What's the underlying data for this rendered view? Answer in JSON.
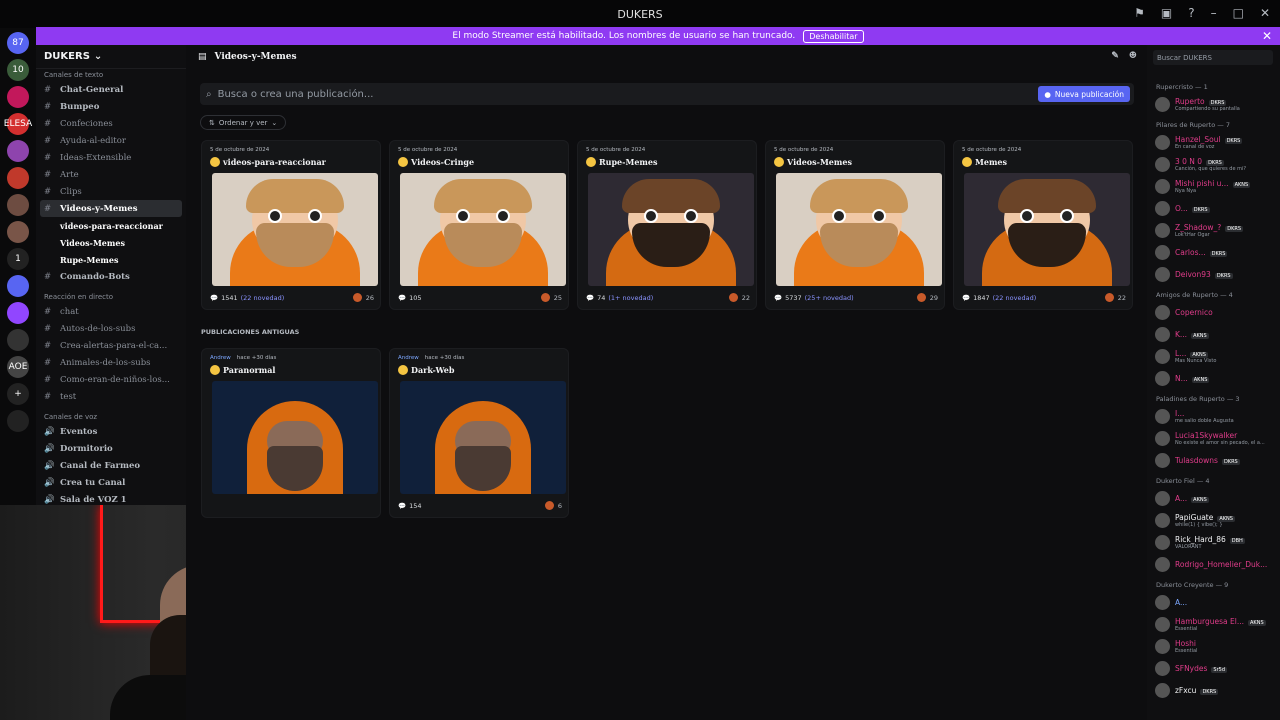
{
  "window": {
    "title": "DUKERS"
  },
  "banner": {
    "text": "El modo Streamer está habilitado. Los nombres de usuario se han truncado.",
    "button": "Deshabilitar"
  },
  "guilds": [
    {
      "label": "87",
      "color": "#5865f2"
    },
    {
      "label": "10",
      "color": "#3a5c3a"
    },
    {
      "label": "",
      "color": "#c2185b"
    },
    {
      "label": "ELESA",
      "color": "#d32f2f"
    },
    {
      "label": "",
      "color": "#8e44ad"
    },
    {
      "label": "",
      "color": "#c0392b"
    },
    {
      "label": "",
      "color": "#6d4c41"
    },
    {
      "label": "",
      "color": "#795548"
    },
    {
      "label": "1",
      "color": "#222"
    },
    {
      "label": "",
      "color": "#5865f2"
    },
    {
      "label": "",
      "color": "#9146ff"
    },
    {
      "label": "",
      "color": "#333"
    },
    {
      "label": "AOE",
      "color": "#444"
    },
    {
      "label": "+",
      "color": "#222"
    },
    {
      "label": "",
      "color": "#222"
    }
  ],
  "server": {
    "name": "DUKERS",
    "text_category": "Canales de texto",
    "channels": [
      {
        "label": "Chat-General",
        "icon": "#",
        "muted": false,
        "sub": false,
        "active": false
      },
      {
        "label": "Bumpeo",
        "icon": "#",
        "muted": false,
        "sub": false,
        "active": false
      },
      {
        "label": "Confeciones",
        "icon": "#",
        "muted": true,
        "sub": false,
        "active": false
      },
      {
        "label": "Ayuda-al-editor",
        "icon": "#",
        "muted": true,
        "sub": false,
        "active": false
      },
      {
        "label": "Ideas-Extensible",
        "icon": "#",
        "muted": true,
        "sub": false,
        "active": false
      },
      {
        "label": "Arte",
        "icon": "#",
        "muted": true,
        "sub": false,
        "active": false
      },
      {
        "label": "Clips",
        "icon": "#",
        "muted": true,
        "sub": false,
        "active": false
      },
      {
        "label": "Videos-y-Memes",
        "icon": "#",
        "muted": false,
        "sub": false,
        "active": true
      },
      {
        "label": "videos-para-reaccionar",
        "icon": "",
        "muted": false,
        "sub": true,
        "active": false
      },
      {
        "label": "Videos-Memes",
        "icon": "",
        "muted": false,
        "sub": true,
        "active": false
      },
      {
        "label": "Rupe-Memes",
        "icon": "",
        "muted": false,
        "sub": true,
        "active": false
      },
      {
        "label": "Comando-Bots",
        "icon": "",
        "muted": false,
        "sub": false,
        "active": false
      }
    ],
    "live_category": "Reacción en directo",
    "live_channels": [
      {
        "label": "chat"
      },
      {
        "label": "Autos-de-los-subs"
      },
      {
        "label": "Crea-alertas-para-el-ca..."
      },
      {
        "label": "Animales-de-los-subs"
      },
      {
        "label": "Como-eran-de-niños-los..."
      },
      {
        "label": "test"
      }
    ],
    "voice_category": "Canales de voz",
    "voice_channels": [
      {
        "label": "Eventos"
      },
      {
        "label": "Dormitorio"
      },
      {
        "label": "Canal de Farmeo"
      },
      {
        "label": "Crea tu Canal"
      },
      {
        "label": "Sala de VOZ 1"
      }
    ]
  },
  "main": {
    "channel_title": "Videos-y-Memes",
    "search_placeholder": "Busca o crea una publicación...",
    "new_post": "Nueva publicación",
    "sort": "Ordenar y ver",
    "old_posts": "PUBLICACIONES ANTIGUAS",
    "posts": [
      {
        "date": "5 de octubre de 2024",
        "title": "videos-para-reaccionar",
        "count": "1541",
        "novelty": "(22 novedad)",
        "reactions": "26",
        "art": "light"
      },
      {
        "date": "5 de octubre de 2024",
        "title": "Videos-Cringe",
        "count": "105",
        "novelty": "",
        "reactions": "25",
        "art": "light"
      },
      {
        "date": "5 de octubre de 2024",
        "title": "Rupe-Memes",
        "count": "74",
        "novelty": "(1+ novedad)",
        "reactions": "22",
        "art": "dark"
      },
      {
        "date": "5 de octubre de 2024",
        "title": "Videos-Memes",
        "count": "5737",
        "novelty": "(25+ novedad)",
        "reactions": "29",
        "art": "light"
      },
      {
        "date": "5 de octubre de 2024",
        "title": "Memes",
        "count": "1847",
        "novelty": "(22 novedad)",
        "reactions": "22",
        "art": "dark"
      }
    ],
    "old": [
      {
        "author": "Andrew",
        "date": "hace +30 días",
        "title": "Paranormal",
        "count": "",
        "reactions": "",
        "art": "night"
      },
      {
        "author": "Andrew",
        "date": "hace +30 días",
        "title": "Dark-Web",
        "count": "154",
        "reactions": "6",
        "art": "night"
      }
    ]
  },
  "members": {
    "search_placeholder": "Buscar DUKERS",
    "groups": [
      {
        "name": "Rupercristo — 1",
        "members": [
          {
            "name": "Ruperto",
            "status": "Compartiendo su pantalla",
            "tag": "DKRS",
            "color": "#e03c8a"
          }
        ]
      },
      {
        "name": "Pilares de Ruperto — 7",
        "members": [
          {
            "name": "Hanzel_Soul",
            "status": "En canal de voz",
            "tag": "DKRS",
            "color": "#e03c8a"
          },
          {
            "name": "3 0 N 0",
            "status": "Canción, que quieres de mi?",
            "tag": "DKRS",
            "color": "#e03c8a"
          },
          {
            "name": "Mishi pishi u...",
            "status": "Nya Nya",
            "tag": "AKNS",
            "color": "#e03c8a"
          },
          {
            "name": "O...",
            "status": "",
            "tag": "DKRS",
            "color": "#e03c8a"
          },
          {
            "name": "Z_Shadow_?",
            "status": "Lok'tHar Ogar",
            "tag": "DKRS",
            "color": "#e03c8a"
          },
          {
            "name": "Carlos...",
            "status": "",
            "tag": "DKRS",
            "color": "#e03c8a"
          },
          {
            "name": "Deivon93",
            "status": "",
            "tag": "DKRS",
            "color": "#e03c8a"
          }
        ]
      },
      {
        "name": "Amigos de Ruperto — 4",
        "members": [
          {
            "name": "Copernico",
            "status": "",
            "tag": "",
            "color": "#e03c8a"
          },
          {
            "name": "K...",
            "status": "",
            "tag": "AKNS",
            "color": "#e03c8a"
          },
          {
            "name": "L...",
            "status": "Mas Nunca Visto",
            "tag": "AKNS",
            "color": "#e03c8a"
          },
          {
            "name": "N...",
            "status": "",
            "tag": "AKNS",
            "color": "#e03c8a"
          }
        ]
      },
      {
        "name": "Paladines de Ruperto — 3",
        "members": [
          {
            "name": "I...",
            "status": "me salio doble Augusta",
            "tag": "",
            "color": "#e03c8a"
          },
          {
            "name": "Lucia1Skywalker",
            "status": "No existe el amor sin pecado, el a...",
            "tag": "",
            "color": "#e03c8a"
          },
          {
            "name": "Tulasdowns",
            "status": "",
            "tag": "DKRS",
            "color": "#e03c8a"
          }
        ]
      },
      {
        "name": "Dukerto Fiel — 4",
        "members": [
          {
            "name": "A...",
            "status": "",
            "tag": "AKNS",
            "color": "#e03c8a"
          },
          {
            "name": "PapiGuate",
            "status": "while(1) { vibe(); }",
            "tag": "AKNS",
            "color": "#f2f3f5"
          },
          {
            "name": "Rick_Hard_86",
            "status": "VALORANT",
            "tag": "DBH",
            "color": "#f2f3f5"
          },
          {
            "name": "Rodrigo_Homelier_Duk...",
            "status": "",
            "tag": "",
            "color": "#e03c8a"
          }
        ]
      },
      {
        "name": "Dukerto Creyente — 9",
        "members": [
          {
            "name": "A...",
            "status": "",
            "tag": "",
            "color": "#7ca7ff"
          },
          {
            "name": "Hamburguesa El...",
            "status": "Essential",
            "tag": "AKNS",
            "color": "#e03c8a"
          },
          {
            "name": "Hoshi",
            "status": "Essential",
            "tag": "",
            "color": "#e03c8a"
          },
          {
            "name": "SFNydes",
            "status": "",
            "tag": "Sr5d",
            "color": "#e03c8a"
          },
          {
            "name": "zFxcu",
            "status": "",
            "tag": "DKRS",
            "color": "#f2f3f5"
          }
        ]
      }
    ]
  }
}
